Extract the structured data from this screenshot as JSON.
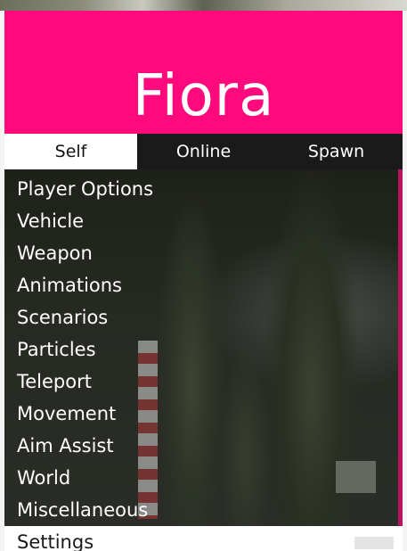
{
  "header": {
    "title": "Fiora",
    "accent": "#ff0a7c"
  },
  "tabs": [
    {
      "label": "Self",
      "active": true
    },
    {
      "label": "Online",
      "active": false
    },
    {
      "label": "Spawn",
      "active": false
    }
  ],
  "items": [
    {
      "label": "Player Options"
    },
    {
      "label": "Vehicle"
    },
    {
      "label": "Weapon"
    },
    {
      "label": "Animations"
    },
    {
      "label": "Scenarios"
    },
    {
      "label": "Particles"
    },
    {
      "label": "Teleport"
    },
    {
      "label": "Movement"
    },
    {
      "label": "Aim Assist"
    },
    {
      "label": "World"
    },
    {
      "label": "Miscellaneous"
    },
    {
      "label": "Settings",
      "selected": true
    }
  ]
}
